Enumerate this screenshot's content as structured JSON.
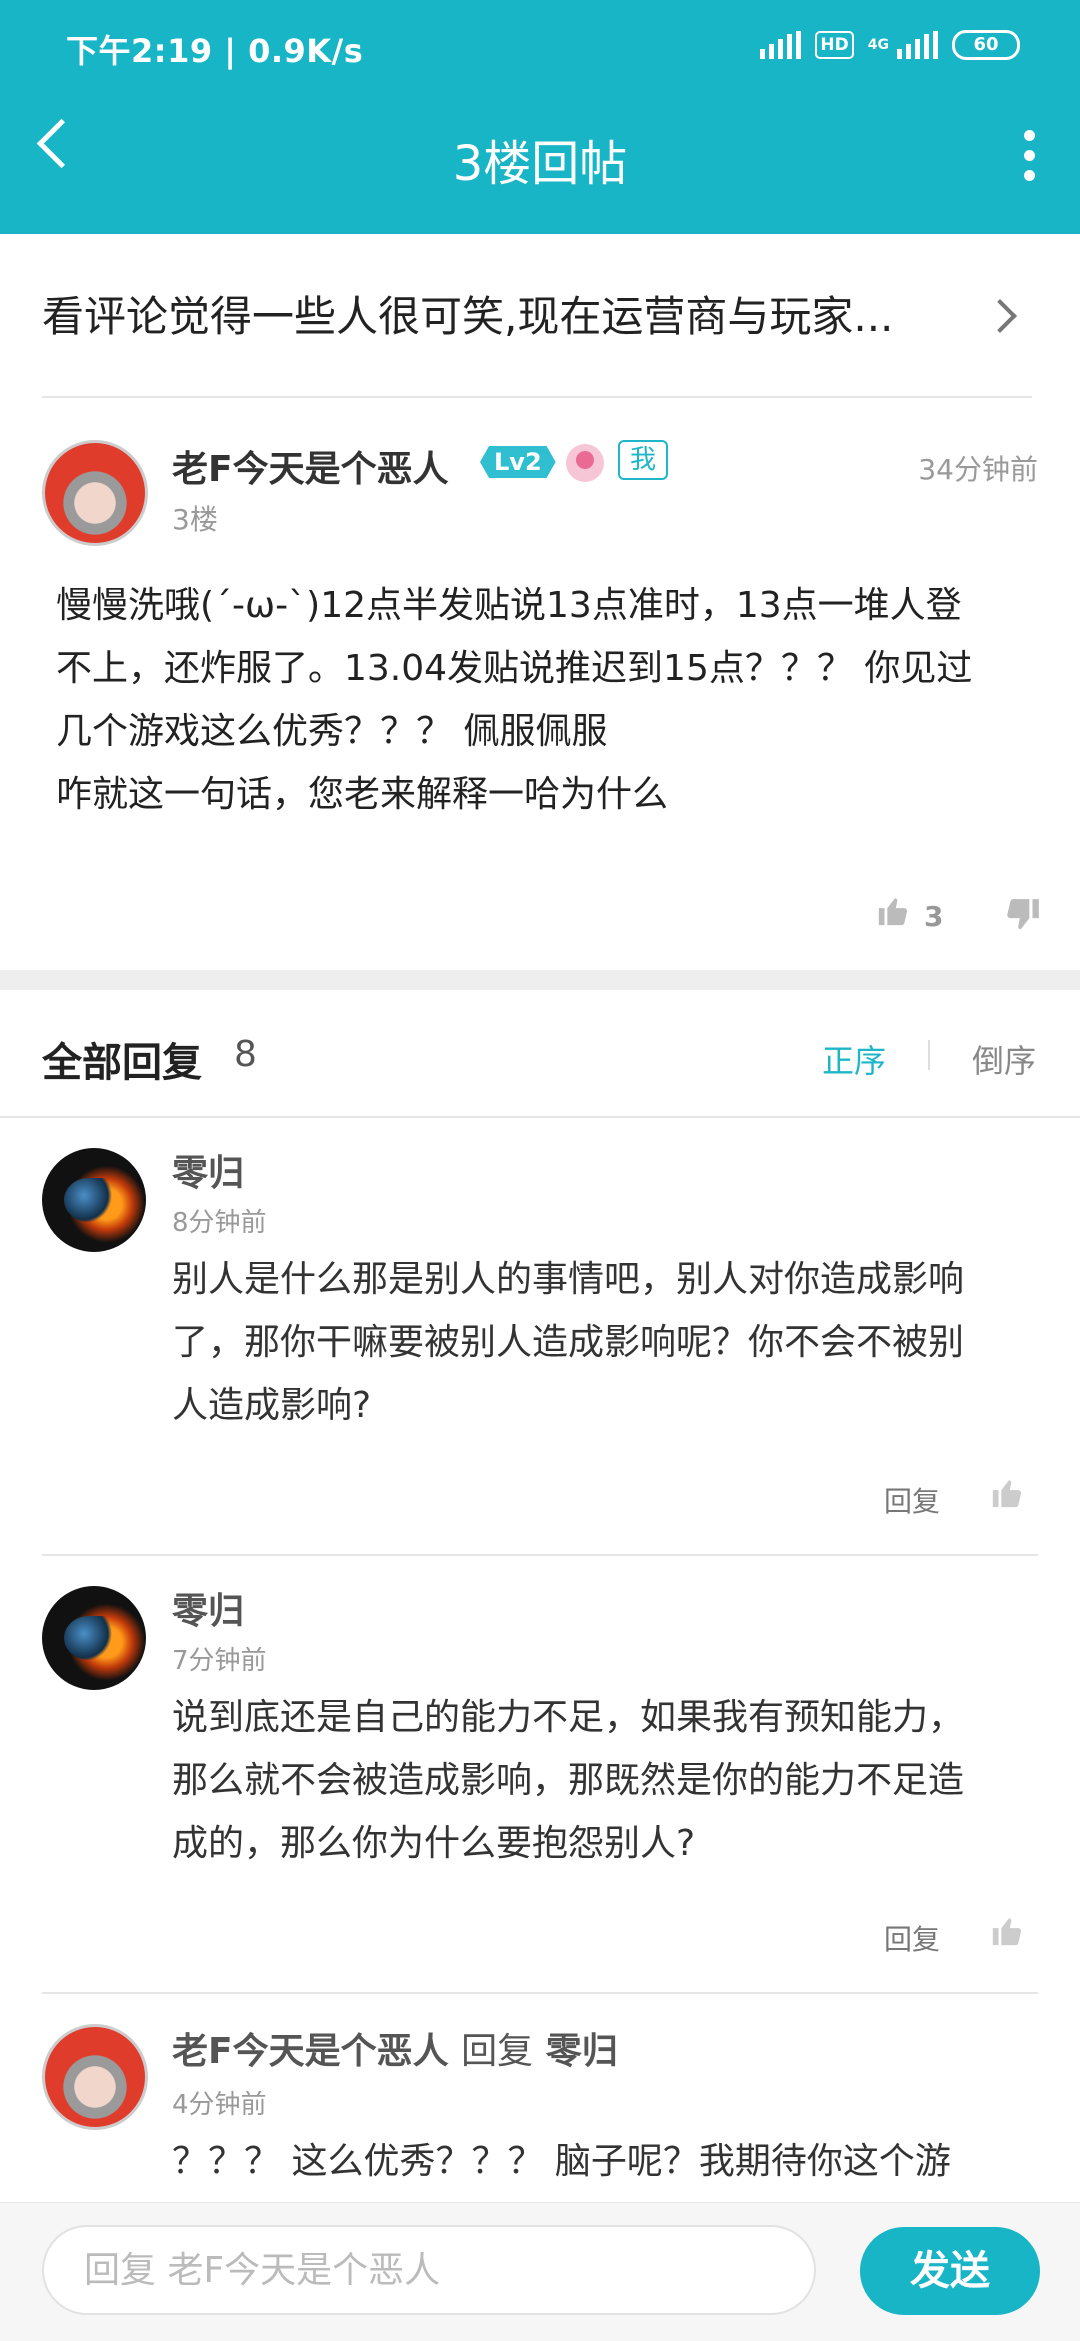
{
  "status_bar": {
    "time_speed": "下午2:19 | 0.9K/s",
    "hd": "HD",
    "network": "4G",
    "battery": "60"
  },
  "header": {
    "title": "3楼回帖"
  },
  "thread": {
    "title": "看评论觉得一些人很可笑,现在运营商与玩家..."
  },
  "post": {
    "author": "老F今天是个恶人",
    "level": "Lv2",
    "me_badge": "我",
    "time": "34分钟前",
    "floor": "3楼",
    "content_lines": [
      "慢慢洗哦(´-ω-`)12点半发贴说13点准时，13点一堆人登",
      "不上，还炸服了。13.04发贴说推迟到15点？？？ 你见过",
      "几个游戏这么优秀？？？ 佩服佩服",
      "咋就这一句话，您老来解释一哈为什么"
    ],
    "likes": "3"
  },
  "replies_section": {
    "title": "全部回复",
    "count": "8",
    "sort_asc": "正序",
    "sort_desc": "倒序"
  },
  "replies": [
    {
      "name": "零归",
      "time": "8分钟前",
      "lines": [
        "别人是什么那是别人的事情吧，别人对你造成影响",
        "了，那你干嘛要被别人造成影响呢？你不会不被别",
        "人造成影响?"
      ],
      "reply_label": "回复"
    },
    {
      "name": "零归",
      "time": "7分钟前",
      "lines": [
        "说到底还是自己的能力不足，如果我有预知能力，",
        "那么就不会被造成影响，那既然是你的能力不足造",
        "成的，那么你为什么要抱怨别人?"
      ],
      "reply_label": "回复"
    },
    {
      "name": "老F今天是个恶人",
      "reply_word": "回复",
      "reply_to": "零归",
      "time": "4分钟前",
      "lines": [
        "？？？ 这么优秀？？？ 脑子呢？我期待你这个游"
      ]
    }
  ],
  "composer": {
    "placeholder": "回复 老F今天是个恶人",
    "send": "发送"
  },
  "colors": {
    "accent": "#17b5c6",
    "text": "#222222",
    "muted": "#999999"
  }
}
